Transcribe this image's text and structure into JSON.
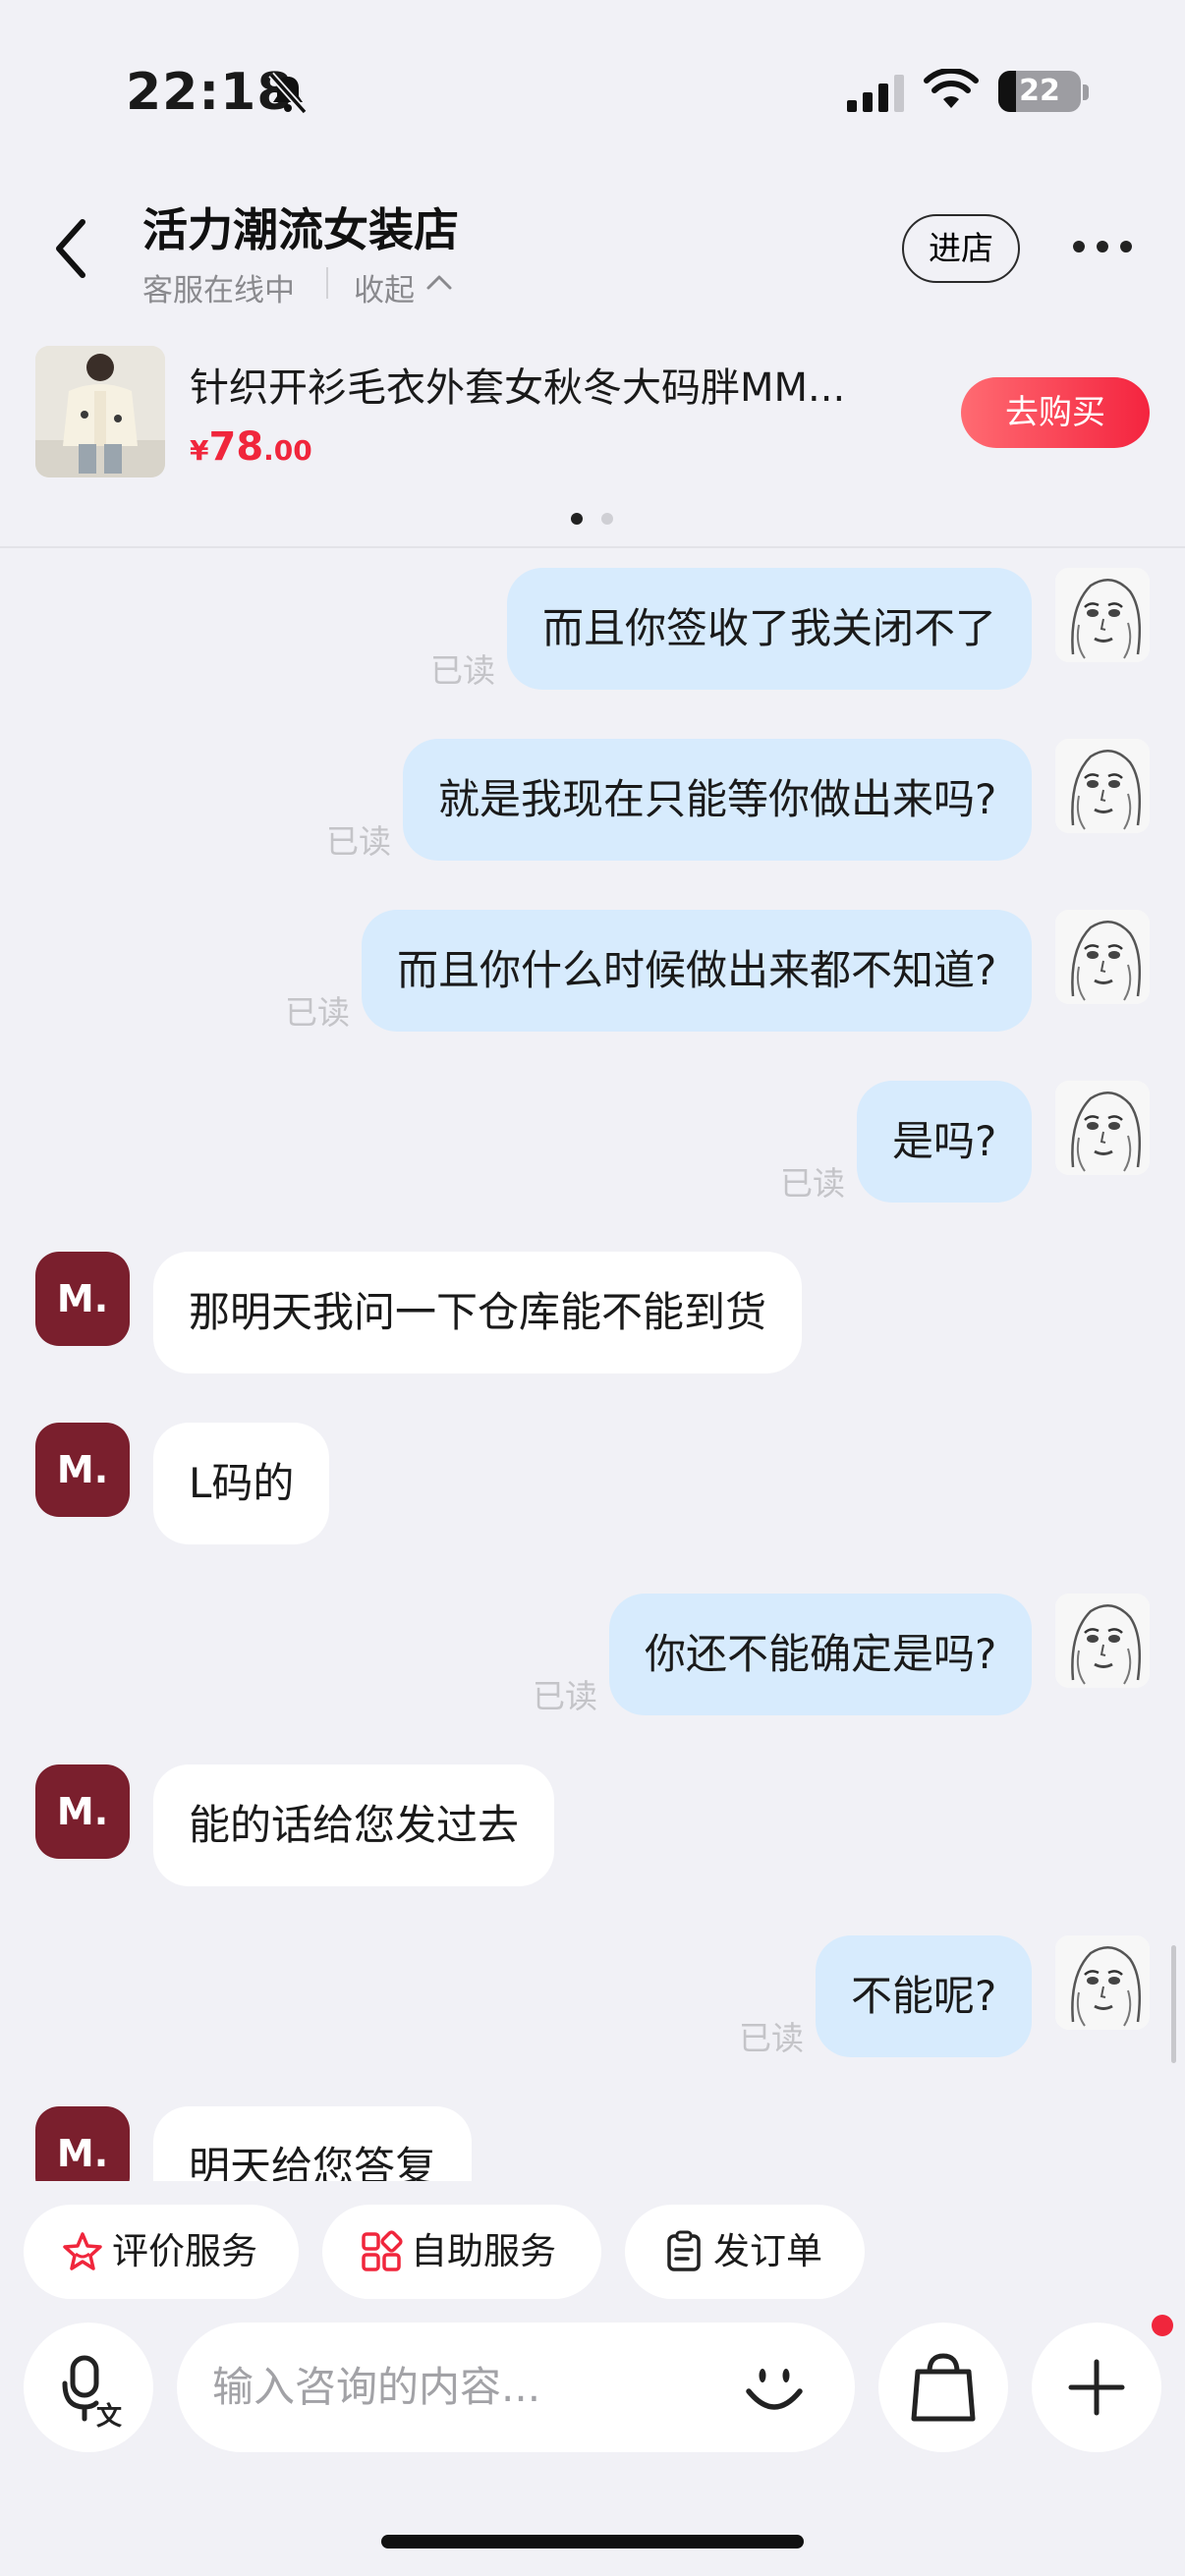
{
  "status_bar": {
    "time": "22:18",
    "battery": "22",
    "battery_level": 0.22
  },
  "header": {
    "title": "活力潮流女装店",
    "status": "客服在线中",
    "collapse_label": "收起",
    "enter_shop_label": "进店"
  },
  "product": {
    "title": "针织开衫毛衣外套女秋冬大码胖MM...",
    "price_currency": "¥",
    "price_int": "78",
    "price_dec": ".00",
    "buy_label": "去购买"
  },
  "read_label": "已读",
  "shop_avatar_text": "M.",
  "messages": [
    {
      "side": "out",
      "text": "而且你签收了我关闭不了"
    },
    {
      "side": "out",
      "text": "就是我现在只能等你做出来吗?"
    },
    {
      "side": "out",
      "text": "而且你什么时候做出来都不知道?"
    },
    {
      "side": "out",
      "text": "是吗?"
    },
    {
      "side": "in",
      "text": "那明天我问一下仓库能不能到货"
    },
    {
      "side": "in",
      "text": "L码的"
    },
    {
      "side": "out",
      "text": "你还不能确定是吗?"
    },
    {
      "side": "in",
      "text": "能的话给您发过去"
    },
    {
      "side": "out",
      "text": "不能呢?"
    },
    {
      "side": "in",
      "text": "明天给您答复"
    }
  ],
  "quick_actions": [
    {
      "label": "评价服务",
      "icon": "star-icon"
    },
    {
      "label": "自助服务",
      "icon": "grid-icon"
    },
    {
      "label": "发订单",
      "icon": "clipboard-icon"
    }
  ],
  "input": {
    "placeholder": "输入咨询的内容..."
  },
  "colors": {
    "accent": "#f0263c",
    "outgoing_bubble": "#d7ebfd",
    "shop_avatar": "#7a1f2d"
  }
}
